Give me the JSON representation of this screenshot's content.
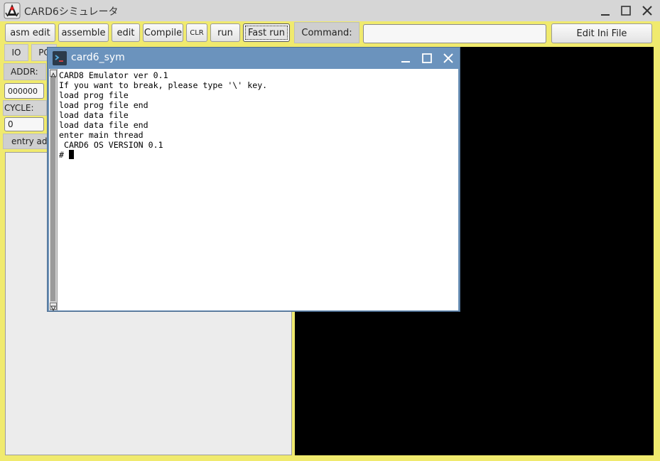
{
  "window": {
    "title": "CARD6シミュレータ",
    "icon": "java-duke-icon",
    "controls": [
      "minimize-icon",
      "maximize-icon",
      "close-icon"
    ]
  },
  "toolbar": {
    "asm_edit": "asm edit",
    "assemble": "assemble",
    "edit": "edit",
    "compile": "Compile",
    "clr": "CLR",
    "run": "run",
    "fast_run": "Fast run",
    "command_label": "Command:",
    "command_value": "",
    "edit_ini": "Edit Ini File"
  },
  "tabs": [
    "IO",
    "PC"
  ],
  "left": {
    "addr_label": "ADDR:",
    "addr_value": "000000",
    "cycle_label": "CYCLE:",
    "cycle_value": "0",
    "entry_label": "entry ad"
  },
  "terminal": {
    "title": "card6_sym",
    "icon": "terminal-icon",
    "lines": [
      "CARD8 Emulator ver 0.1",
      "If you want to break, please type '\\' key.",
      "load prog file",
      "load prog file end",
      "load data file",
      "load data file end",
      "enter main thread",
      " CARD6 OS VERSION 0.1"
    ],
    "prompt": "# "
  },
  "colors": {
    "frame": "#f0ea6e",
    "terminal_title": "#6b93bd",
    "display": "#000000"
  }
}
